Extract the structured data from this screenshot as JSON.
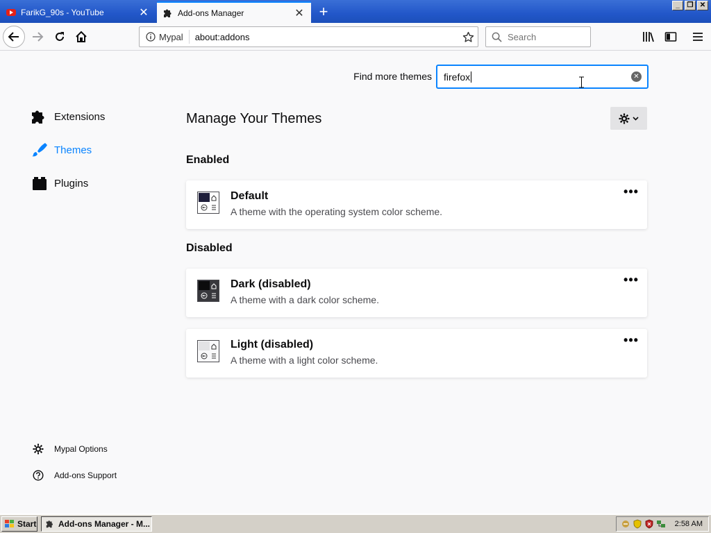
{
  "browser": {
    "tabs": [
      {
        "title": "FarikG_90s - YouTube",
        "icon": "youtube-icon",
        "active": false
      },
      {
        "title": "Add-ons Manager",
        "icon": "puzzle-icon",
        "active": true
      }
    ],
    "identity_label": "Mypal",
    "url": "about:addons",
    "search_placeholder": "Search"
  },
  "addons": {
    "find_label": "Find more themes",
    "find_value": "firefox",
    "categories": [
      {
        "label": "Extensions",
        "icon": "puzzle-icon",
        "selected": false
      },
      {
        "label": "Themes",
        "icon": "brush-icon",
        "selected": true
      },
      {
        "label": "Plugins",
        "icon": "plugin-icon",
        "selected": false
      }
    ],
    "page_title": "Manage Your Themes",
    "enabled_heading": "Enabled",
    "disabled_heading": "Disabled",
    "themes": [
      {
        "name": "Default",
        "description": "A theme with the operating system color scheme.",
        "icon": "default-theme-icon"
      },
      {
        "name": "Dark (disabled)",
        "description": "A theme with a dark color scheme.",
        "icon": "dark-theme-icon"
      },
      {
        "name": "Light (disabled)",
        "description": "A theme with a light color scheme.",
        "icon": "light-theme-icon"
      }
    ],
    "more_label": "•••",
    "footer": [
      {
        "label": "Mypal Options",
        "icon": "gear-icon"
      },
      {
        "label": "Add-ons Support",
        "icon": "help-icon"
      }
    ]
  },
  "taskbar": {
    "start_label": "Start",
    "task_label": "Add-ons Manager - M...",
    "clock": "2:58 AM"
  },
  "colors": {
    "accent": "#0a84ff",
    "titlebar": "#2257c9",
    "taskbar": "#d4d0c8"
  }
}
